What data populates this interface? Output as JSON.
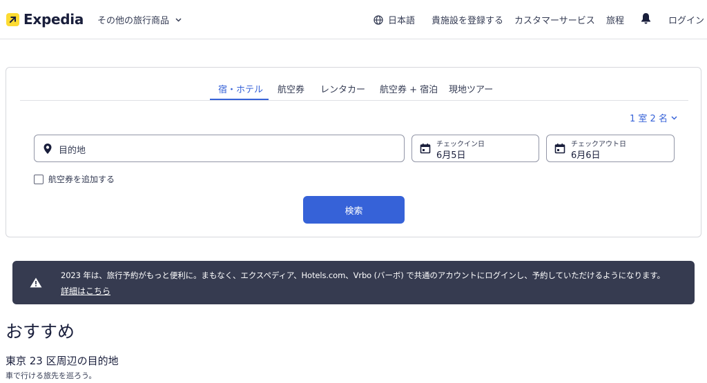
{
  "header": {
    "logo_text": "Expedia",
    "other_products": "その他の旅行商品",
    "language": "日本語",
    "list_property": "貴施設を登録する",
    "customer_service": "カスタマーサービス",
    "trips": "旅程",
    "login": "ログイン"
  },
  "search": {
    "tabs": [
      {
        "label": "宿・ホテル",
        "active": true
      },
      {
        "label": "航空券",
        "active": false
      },
      {
        "label": "レンタカー",
        "active": false
      },
      {
        "label": "航空券 + 宿泊",
        "active": false
      },
      {
        "label": "現地ツアー",
        "active": false
      }
    ],
    "travelers": "1 室 2 名",
    "destination_placeholder": "目的地",
    "checkin_label": "チェックイン日",
    "checkin_value": "6月5日",
    "checkout_label": "チェックアウト日",
    "checkout_value": "6月6日",
    "add_flight_label": "航空券を追加する",
    "add_flight_checked": false,
    "search_button": "検索"
  },
  "notice": {
    "message": "2023 年は、旅行予約がもっと便利に。まもなく、エクスペディア、Hotels.com、Vrbo (バーボ) で共通のアカウントにログインし、予約していただけるようになります。",
    "link": "詳細はこちら"
  },
  "recommendations": {
    "title": "おすすめ",
    "subtitle": "東京 23 区周辺の目的地",
    "description": "車で行ける旅先を巡ろう。"
  },
  "colors": {
    "brand_yellow": "#fddb32",
    "primary_blue": "#3662d8",
    "banner_bg": "#363b50",
    "text_dark": "#191e3b"
  }
}
